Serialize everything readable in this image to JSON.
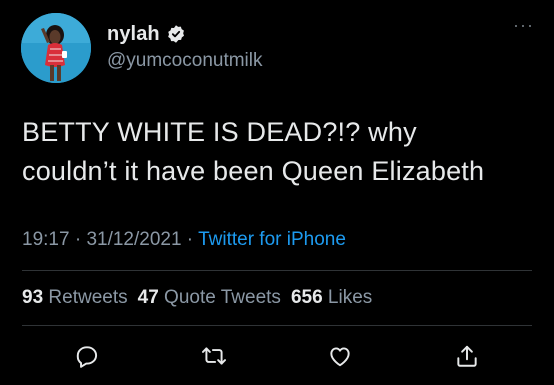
{
  "user": {
    "display_name": "nylah",
    "handle": "@yumcoconutmilk",
    "verified": true
  },
  "more_menu_icon": "more-horizontal-icon",
  "tweet": {
    "text_line1": "BETTY WHITE IS DEAD?!? why",
    "text_line2": "couldn’t it have been Queen Elizabeth"
  },
  "meta": {
    "time": "19:17",
    "separator": " · ",
    "date": "31/12/2021",
    "source": "Twitter for iPhone"
  },
  "stats": {
    "retweets_count": "93",
    "retweets_label": "Retweets",
    "quotes_count": "47",
    "quotes_label": "Quote Tweets",
    "likes_count": "656",
    "likes_label": "Likes"
  },
  "actions": [
    "reply-icon",
    "retweet-icon",
    "like-icon",
    "share-icon"
  ],
  "colors": {
    "background": "#000000",
    "text": "#e7e9ea",
    "muted": "#8b98a5",
    "link": "#1d9bf0",
    "divider": "#2f3336"
  }
}
